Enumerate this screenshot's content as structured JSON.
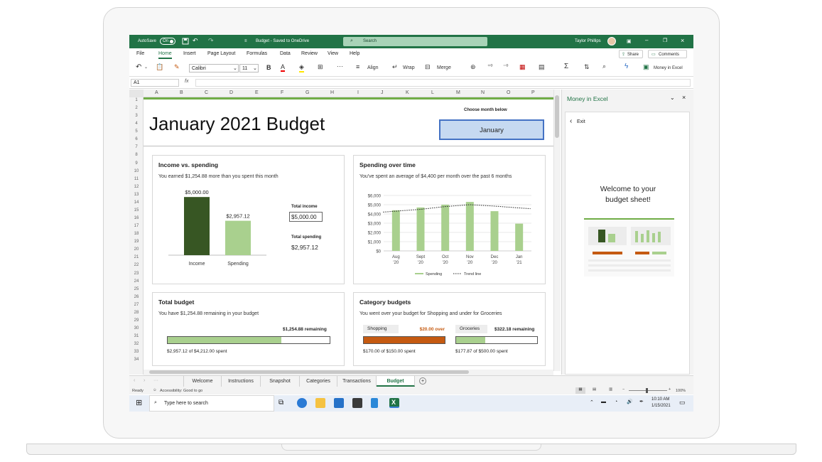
{
  "window": {
    "autosave_label": "AutoSave",
    "autosave_state": "On",
    "document_title": "Budget - Saved to OneDrive",
    "search_placeholder": "Search",
    "user_name": "Taylor Phillips"
  },
  "menu": {
    "items": [
      "File",
      "Home",
      "Insert",
      "Page Layout",
      "Formulas",
      "Data",
      "Review",
      "View",
      "Help"
    ],
    "share_label": "Share",
    "comments_label": "Comments"
  },
  "ribbon": {
    "font_name": "Calibri",
    "font_size": "11",
    "bold_label": "B",
    "align_label": "Align",
    "wrap_label": "Wrap",
    "merge_label": "Merge",
    "money_label": "Money in Excel"
  },
  "formula_bar": {
    "name_box": "A1",
    "fx_label": "fx"
  },
  "columns": [
    "A",
    "B",
    "C",
    "D",
    "E",
    "F",
    "G",
    "H",
    "I",
    "J",
    "K",
    "L",
    "M",
    "N",
    "O",
    "P"
  ],
  "rows": [
    "1",
    "2",
    "3",
    "4",
    "5",
    "6",
    "7",
    "8",
    "9",
    "10",
    "11",
    "12",
    "13",
    "14",
    "15",
    "16",
    "17",
    "18",
    "19",
    "20",
    "21",
    "22",
    "23",
    "24",
    "25",
    "26",
    "27",
    "28",
    "29",
    "30",
    "31",
    "32",
    "33",
    "34"
  ],
  "sheet": {
    "title": "January 2021 Budget",
    "month_label": "Choose month below",
    "month_value": "January"
  },
  "income_card": {
    "title": "Income vs. spending",
    "subtitle": "You earned $1,254.88 more than you spent this month",
    "income_value_label": "$5,000.00",
    "spending_value_label": "$2,957.12",
    "income_axis": "Income",
    "spending_axis": "Spending",
    "total_income_label": "Total income",
    "total_income_value": "$5,000.00",
    "total_spending_label": "Total spending",
    "total_spending_value": "$2,957.12",
    "colors": {
      "income": "#375623",
      "spending": "#a9d08e"
    }
  },
  "spending_card": {
    "title": "Spending over time",
    "subtitle": "You've spent an average of $4,400 per month over the past 6 months",
    "legend_spending": "Spending",
    "legend_trend": "Trend line"
  },
  "total_budget_card": {
    "title": "Total budget",
    "subtitle": "You have $1,254.88 remaining in your budget",
    "remaining_label": "$1,254.88 remaining",
    "spent_label": "$2,957.12 of $4,212.00 spent",
    "fill_fraction": 0.702
  },
  "category_card": {
    "title": "Category budgets",
    "subtitle": "You went over your budget for Shopping and under for Groceries",
    "shopping_label": "Shopping",
    "shopping_status": "$20.00 over",
    "shopping_spent": "$170.00 of $150.00 spent",
    "shopping_fraction": 1.0,
    "groceries_label": "Groceries",
    "groceries_status": "$322.18 remaining",
    "groceries_spent": "$177.87 of $500.00 spent",
    "groceries_fraction": 0.356,
    "colors": {
      "over": "#c55a11",
      "under": "#a9d08e"
    }
  },
  "chart_data": [
    {
      "type": "bar",
      "title": "Income vs. spending",
      "categories": [
        "Income",
        "Spending"
      ],
      "values": [
        5000.0,
        2957.12
      ],
      "data_labels": [
        "$5,000.00",
        "$2,957.12"
      ],
      "ylim": [
        0,
        5500
      ]
    },
    {
      "type": "bar",
      "title": "Spending over time",
      "categories": [
        "Aug '20",
        "Sept '20",
        "Oct '20",
        "Nov '20",
        "Dec '20",
        "Jan '21"
      ],
      "category_lines": [
        [
          "Aug",
          "'20"
        ],
        [
          "Sept",
          "'20"
        ],
        [
          "Oct",
          "'20"
        ],
        [
          "Nov",
          "'20"
        ],
        [
          "Dec",
          "'20"
        ],
        [
          "Jan",
          "'21"
        ]
      ],
      "series": [
        {
          "name": "Spending",
          "values": [
            4400,
            4700,
            5000,
            5300,
            4300,
            2950
          ]
        },
        {
          "name": "Trend line",
          "values": [
            4200,
            4500,
            4800,
            5000,
            4850,
            4650
          ]
        }
      ],
      "yticks": [
        "$0",
        "$1,000",
        "$2,000",
        "$3,000",
        "$4,000",
        "$5,000",
        "$6,000"
      ],
      "ylim": [
        0,
        6000
      ],
      "grid": true,
      "legend": "bottom"
    }
  ],
  "tabs": [
    "Welcome",
    "Instructions",
    "Snapshot",
    "Categories",
    "Transactions",
    "Budget"
  ],
  "active_tab": "Budget",
  "status": {
    "ready": "Ready",
    "accessibility": "Accessibility: Good to go",
    "zoom": "100%"
  },
  "taskbar": {
    "search_placeholder": "Type here to search",
    "time": "10:10 AM",
    "date": "1/15/2021"
  },
  "side_pane": {
    "title": "Money in Excel",
    "exit_label": "Exit",
    "welcome_line1": "Welcome to your",
    "welcome_line2": "budget sheet!"
  }
}
